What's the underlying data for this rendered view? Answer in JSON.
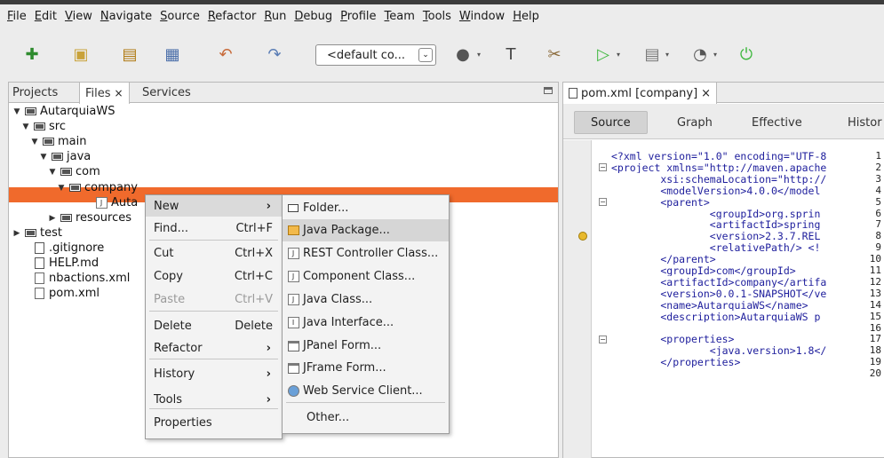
{
  "menubar": [
    "File",
    "Edit",
    "View",
    "Navigate",
    "Source",
    "Refactor",
    "Run",
    "Debug",
    "Profile",
    "Team",
    "Tools",
    "Window",
    "Help"
  ],
  "toolbar": {
    "config_value": "<default co...",
    "icons": [
      "new-file-icon",
      "new-project-icon",
      "open-project-icon",
      "save-all-icon",
      "undo-icon",
      "redo-icon",
      "globe-icon",
      "hammer-icon",
      "clean-build-icon",
      "run-icon",
      "debug-icon",
      "profile-icon",
      "power-icon"
    ]
  },
  "left_tabs": [
    {
      "label": "Projects",
      "active": false
    },
    {
      "label": "Files",
      "active": true,
      "close": "×"
    },
    {
      "label": "Services",
      "active": false
    }
  ],
  "tree": [
    {
      "label": "AutarquiaWS",
      "toggle": "▼",
      "icon": "project"
    },
    {
      "label": "src",
      "toggle": "▼",
      "icon": "folder"
    },
    {
      "label": "main",
      "toggle": "▼",
      "icon": "folder"
    },
    {
      "label": "java",
      "toggle": "▼",
      "icon": "folder"
    },
    {
      "label": "com",
      "toggle": "▼",
      "icon": "folder"
    },
    {
      "label": "company",
      "toggle": "▼",
      "icon": "folder",
      "selected": true
    },
    {
      "label": "Auta",
      "toggle": "",
      "icon": "class"
    },
    {
      "label": "resources",
      "toggle": "▶",
      "icon": "folder"
    },
    {
      "label": "test",
      "toggle": "▶",
      "icon": "folder"
    },
    {
      "label": ".gitignore",
      "toggle": "",
      "icon": "file"
    },
    {
      "label": "HELP.md",
      "toggle": "",
      "icon": "file"
    },
    {
      "label": "nbactions.xml",
      "toggle": "",
      "icon": "xml"
    },
    {
      "label": "pom.xml",
      "toggle": "",
      "icon": "xml"
    }
  ],
  "context_menu": [
    {
      "label": "New",
      "shortcut": "",
      "submenu": true,
      "highlighted": true
    },
    {
      "label": "Find...",
      "shortcut": "Ctrl+F"
    },
    {
      "label": "Cut",
      "shortcut": "Ctrl+X"
    },
    {
      "label": "Copy",
      "shortcut": "Ctrl+C"
    },
    {
      "label": "Paste",
      "shortcut": "Ctrl+V",
      "disabled": true
    },
    {
      "label": "Delete",
      "shortcut": "Delete"
    },
    {
      "label": "Refactor",
      "shortcut": "",
      "submenu": true
    },
    {
      "label": "History",
      "shortcut": "",
      "submenu": true
    },
    {
      "label": "Tools",
      "shortcut": "",
      "submenu": true
    },
    {
      "label": "Properties",
      "shortcut": ""
    }
  ],
  "submenu": [
    {
      "label": "Folder...",
      "icon": "folder-icon"
    },
    {
      "label": "Java Package...",
      "icon": "package-icon",
      "highlighted": true
    },
    {
      "label": "REST Controller Class...",
      "icon": "class-icon"
    },
    {
      "label": "Component Class...",
      "icon": "class-icon"
    },
    {
      "label": "Java Class...",
      "icon": "class-icon"
    },
    {
      "label": "Java Interface...",
      "icon": "interface-icon"
    },
    {
      "label": "JPanel Form...",
      "icon": "form-icon"
    },
    {
      "label": "JFrame Form...",
      "icon": "form-icon"
    },
    {
      "label": "Web Service Client...",
      "icon": "web-service-icon"
    },
    {
      "label": "Other...",
      "icon": ""
    }
  ],
  "editor": {
    "tab_label": "pom.xml [company]",
    "tab_close": "×",
    "views": [
      "Source",
      "Graph",
      "Effective",
      "Histor"
    ],
    "lines": [
      {
        "n": "1",
        "text": "<?xml version=\"1.0\" encoding=\"UTF-8"
      },
      {
        "n": "2",
        "text": "<project xmlns=\"http://maven.apache"
      },
      {
        "n": "3",
        "text": "        xsi:schemaLocation=\"http://"
      },
      {
        "n": "4",
        "text": "        <modelVersion>4.0.0</model"
      },
      {
        "n": "5",
        "text": "        <parent>"
      },
      {
        "n": "6",
        "text": "                <groupId>org.sprin"
      },
      {
        "n": "7",
        "text": "                <artifactId>spring"
      },
      {
        "n": "8",
        "text": "                <version>2.3.7.REL"
      },
      {
        "n": "9",
        "text": "                <relativePath/> <!"
      },
      {
        "n": "10",
        "text": "        </parent>"
      },
      {
        "n": "11",
        "text": "        <groupId>com</groupId>"
      },
      {
        "n": "12",
        "text": "        <artifactId>company</artifa"
      },
      {
        "n": "13",
        "text": "        <version>0.0.1-SNAPSHOT</ve"
      },
      {
        "n": "14",
        "text": "        <name>AutarquiaWS</name>"
      },
      {
        "n": "15",
        "text": "        <description>AutarquiaWS p"
      },
      {
        "n": "16",
        "text": ""
      },
      {
        "n": "17",
        "text": "        <properties>"
      },
      {
        "n": "18",
        "text": "                <java.version>1.8</"
      },
      {
        "n": "19",
        "text": "        </properties>"
      },
      {
        "n": "20",
        "text": ""
      }
    ]
  },
  "colors": {
    "selection": "#f06a2c",
    "menu_highlight": "#dadada",
    "run_green": "#3fb83f"
  }
}
